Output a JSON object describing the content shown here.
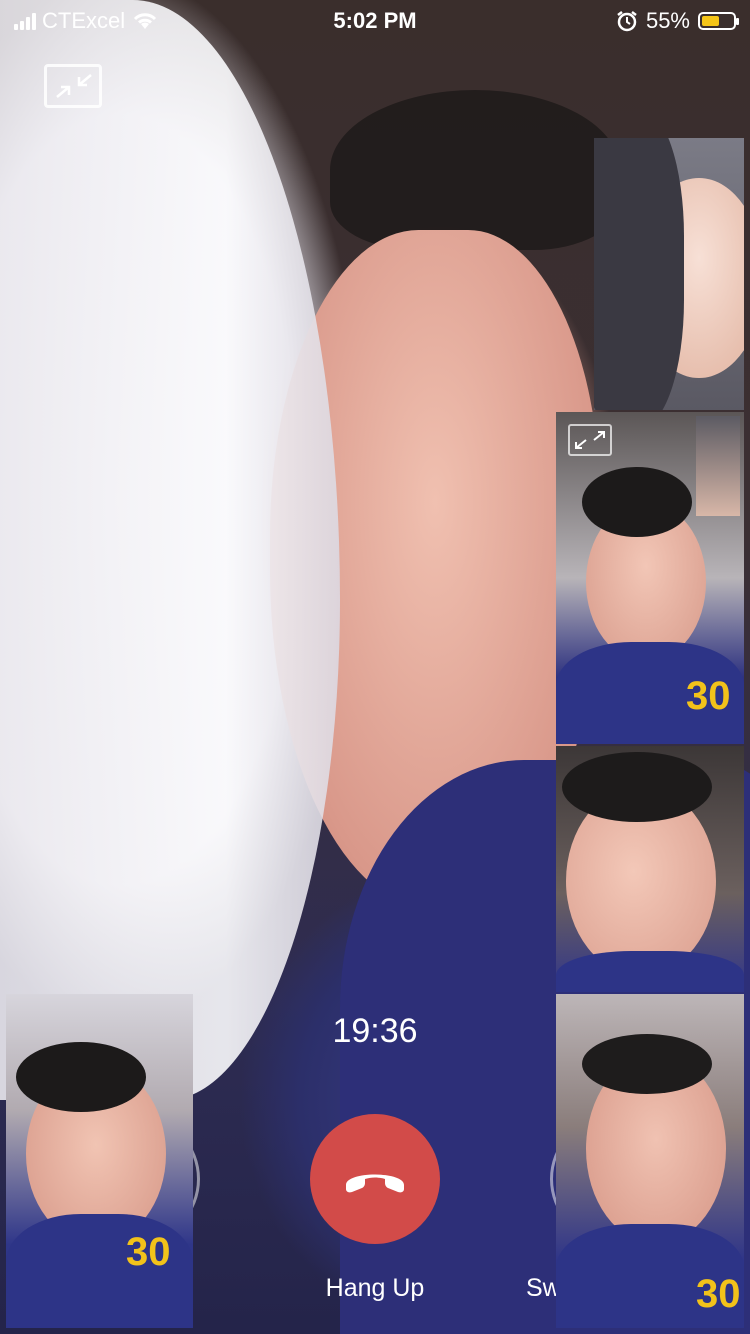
{
  "status_bar": {
    "carrier": "CTExcel",
    "time": "5:02 PM",
    "battery_percent": "55%",
    "battery_level": 0.55,
    "battery_color": "#f5c518",
    "icons": [
      "signal-icon",
      "wifi-icon",
      "alarm-icon",
      "battery-icon"
    ]
  },
  "call": {
    "duration": "19:36",
    "hang_up_label": "Hang Up",
    "switch_label_partial": "Sw",
    "hang_up_color": "#d24b49"
  },
  "tiles": {
    "jersey_number": "30"
  },
  "icons": {
    "minimize": "minimize-icon",
    "expand": "expand-icon",
    "hang_up": "phone-hangup-icon"
  }
}
